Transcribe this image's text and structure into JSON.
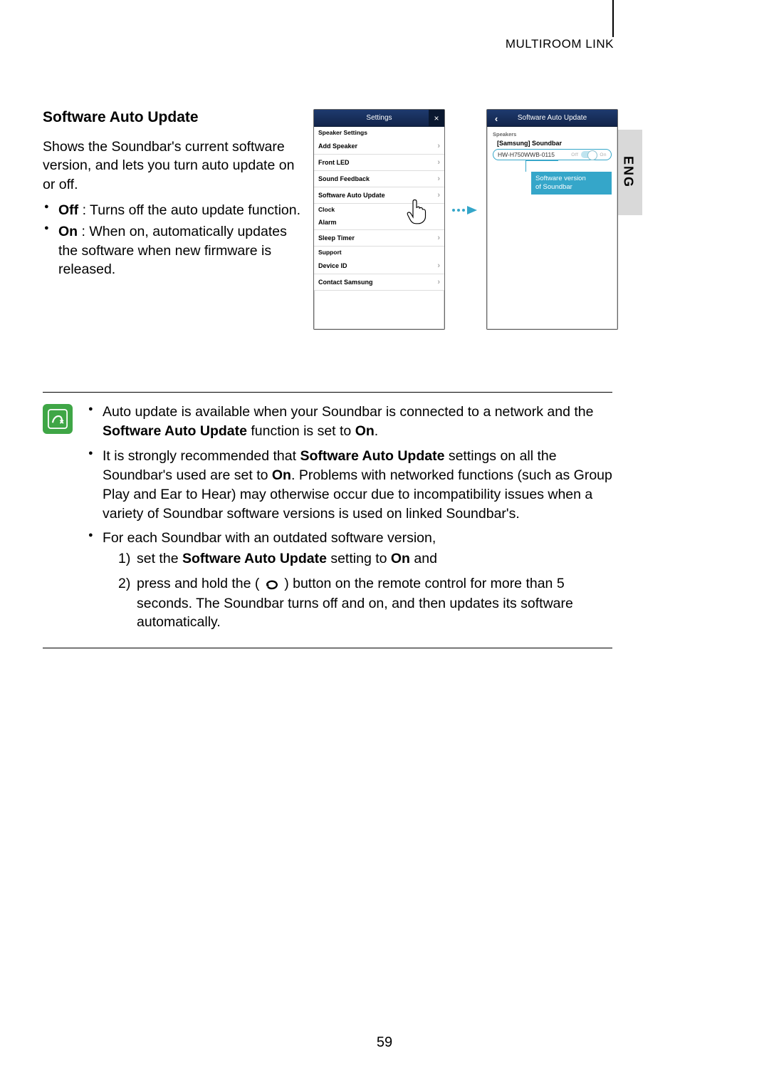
{
  "header": {
    "section": "MULTIROOM LINK",
    "lang_tab": "ENG"
  },
  "section": {
    "title": "Software Auto Update",
    "desc": "Shows the Soundbar's current software version, and lets you turn auto update on or off.",
    "bullet_off_label": "Off",
    "bullet_off_text": " : Turns off the auto update function.",
    "bullet_on_label": "On",
    "bullet_on_text": " : When on, automatically updates the software when new firmware is released."
  },
  "settings_screen": {
    "title": "Settings",
    "section1": "Speaker Settings",
    "rows1": [
      "Add Speaker",
      "Front LED",
      "Sound Feedback",
      "Software Auto Update"
    ],
    "section2": "Clock",
    "rows2": [
      "Alarm",
      "Sleep Timer"
    ],
    "section3": "Support",
    "rows3": [
      "Device ID",
      "Contact Samsung"
    ]
  },
  "sau_screen": {
    "title": "Software Auto Update",
    "speakers_label": "Speakers",
    "device_name": "[Samsung] Soundbar",
    "version": "HW-H750WWB-0115",
    "toggle_off": "Off",
    "toggle_on": "On",
    "callout_line1": "Software version",
    "callout_line2": "of Soundbar"
  },
  "notes": {
    "n1_a": "Auto update is available when your Soundbar is connected to a network and the ",
    "n1_b": "Software Auto Update",
    "n1_c": " function is set to ",
    "n1_d": "On",
    "n1_e": ".",
    "n2_a": "It is strongly recommended that ",
    "n2_b": "Software Auto Update",
    "n2_c": " settings on all the Soundbar's used are set to ",
    "n2_d": "On",
    "n2_e": ". Problems with networked functions (such as Group Play and Ear to Hear) may otherwise occur due to incompatibility issues when a variety of Soundbar software versions is used on linked Soundbar's.",
    "n3": "For each Soundbar with an outdated software version,",
    "s1_num": "1)",
    "s1_a": "set the ",
    "s1_b": "Software Auto Update",
    "s1_c": " setting to ",
    "s1_d": "On",
    "s1_e": " and",
    "s2_num": "2)",
    "s2_a": "press and hold the ( ",
    "s2_b": " ) button on the remote control for more than 5 seconds. The Soundbar turns off and on, and then updates its software automatically."
  },
  "page_number": "59"
}
